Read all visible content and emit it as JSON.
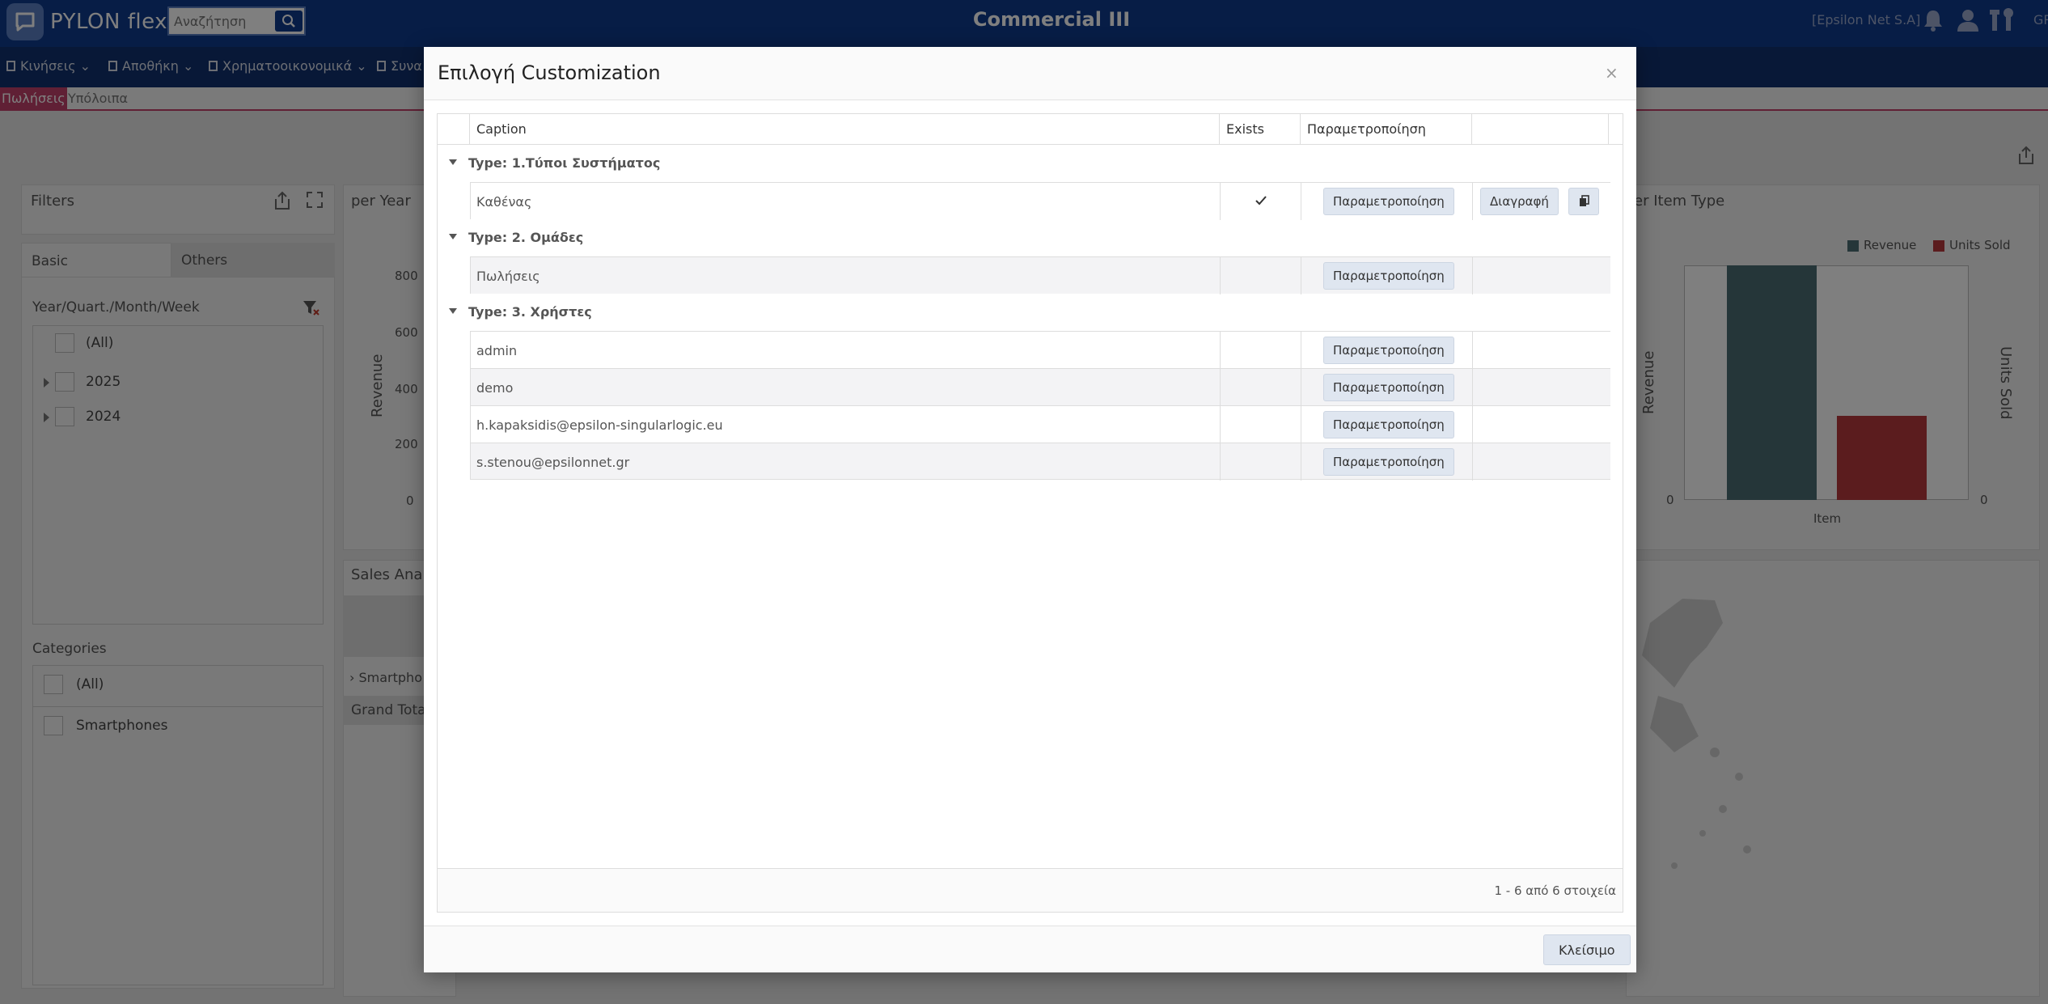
{
  "header": {
    "logo_text": "PYLON flex",
    "search_placeholder": "Αναζήτηση",
    "app_title": "Commercial III",
    "company": "[Epsilon Net S.A]",
    "lang": "GR",
    "icons": [
      "bell-icon",
      "user-icon",
      "tools-icon"
    ]
  },
  "menu": {
    "items": [
      {
        "label": "Κινήσεις",
        "icon": "doc-icon"
      },
      {
        "label": "Αποθήκη",
        "icon": "warehouse-icon"
      },
      {
        "label": "Χρηματοοικονομικά",
        "icon": "finance-icon"
      },
      {
        "label": "Συνα",
        "icon": "binoculars-icon"
      }
    ]
  },
  "tabs": {
    "active": "Πωλήσεις",
    "other": "Υπόλοιπα"
  },
  "dashboard": {
    "filters": {
      "title": "Filters",
      "tab_basic": "Basic",
      "tab_others": "Others",
      "date_label": "Year/Quart./Month/Week",
      "date_items": [
        "(All)",
        "2025",
        "2024"
      ],
      "categories_label": "Categories",
      "category_items": [
        "(All)",
        "Smartphones"
      ]
    },
    "per_year": {
      "title": "per Year",
      "ylabel": "Revenue",
      "ticks": [
        "800",
        "600",
        "400",
        "200",
        "0"
      ]
    },
    "sales_analysis": {
      "title": "Sales Analys",
      "row_label": "Smartpho",
      "grand_total": "Grand Total"
    },
    "item_type_chart": {
      "title": "er Item Type",
      "legend": [
        {
          "name": "Revenue",
          "color": "#4a6d73"
        },
        {
          "name": "Units Sold",
          "color": "#b6393c"
        }
      ],
      "ylabel_left": "Revenue",
      "ylabel_right": "Units Sold",
      "xlabel": "Item",
      "tick_left": "0",
      "tick_right": "0"
    }
  },
  "modal": {
    "title": "Επιλογή Customization",
    "close_icon": "×",
    "columns": [
      "Caption",
      "Exists",
      "Παραμετροποίηση",
      ""
    ],
    "groups": [
      {
        "label": "Type: 1.Τύποι Συστήματος",
        "rows": [
          {
            "caption": "Καθένας",
            "exists": true,
            "edit_label": "Παραμετροποίηση",
            "delete_label": "Διαγραφή",
            "has_copy": true
          }
        ]
      },
      {
        "label": "Type: 2. Ομάδες",
        "rows": [
          {
            "caption": "Πωλήσεις",
            "exists": false,
            "edit_label": "Παραμετροποίηση"
          }
        ]
      },
      {
        "label": "Type: 3. Χρήστες",
        "rows": [
          {
            "caption": "admin",
            "exists": false,
            "edit_label": "Παραμετροποίηση"
          },
          {
            "caption": "demo",
            "exists": false,
            "edit_label": "Παραμετροποίηση"
          },
          {
            "caption": "h.kapaksidis@epsilon-singularlogic.eu",
            "exists": false,
            "edit_label": "Παραμετροποίηση"
          },
          {
            "caption": "s.stenou@epsilonnet.gr",
            "exists": false,
            "edit_label": "Παραμετροποίηση"
          }
        ]
      }
    ],
    "pager_info": "1 - 6 από 6 στοιχεία",
    "close_label": "Κλείσιμο"
  }
}
